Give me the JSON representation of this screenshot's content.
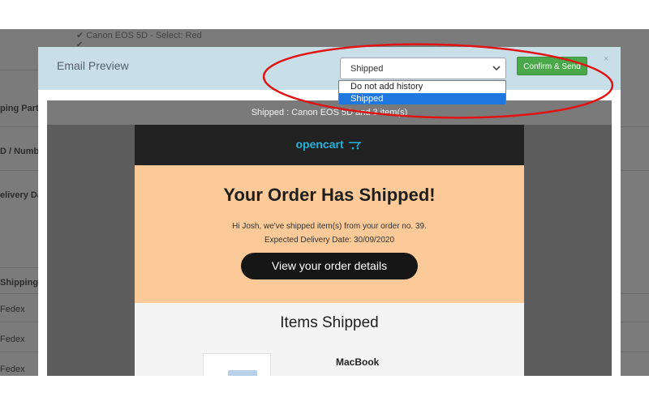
{
  "background": {
    "top_rows": [
      "Canon EOS 5D  - Select: Red",
      ""
    ],
    "left_labels": [
      "ping Partn",
      "D / Numb",
      "elivery Da",
      "Shipping"
    ],
    "left_cells": [
      "Fedex",
      "Fedex",
      "Fedex"
    ]
  },
  "modal": {
    "title": "Email Preview",
    "select": {
      "current": "Shipped",
      "options": [
        "Do not add history",
        "Shipped"
      ],
      "highlighted": "Shipped"
    },
    "confirm_label": "Confirm & Send",
    "close_label": "×"
  },
  "preview": {
    "subject": "Shipped : Canon EOS 5D and 3 item(s)",
    "brand": "opencart",
    "heading": "Your Order Has Shipped!",
    "greeting": "Hi Josh, we've shipped item(s) from your order no. 39.",
    "delivery": "Expected Delivery Date: 30/09/2020",
    "cta": "View your order details",
    "items_title": "Items Shipped",
    "items": [
      {
        "name": "MacBook"
      }
    ]
  },
  "colors": {
    "header_bg": "#c9dfe8",
    "confirm_bg": "#4aa84b",
    "hero_bg": "#fbca98",
    "highlight": "#1e78e0",
    "annotation": "#e01414"
  }
}
